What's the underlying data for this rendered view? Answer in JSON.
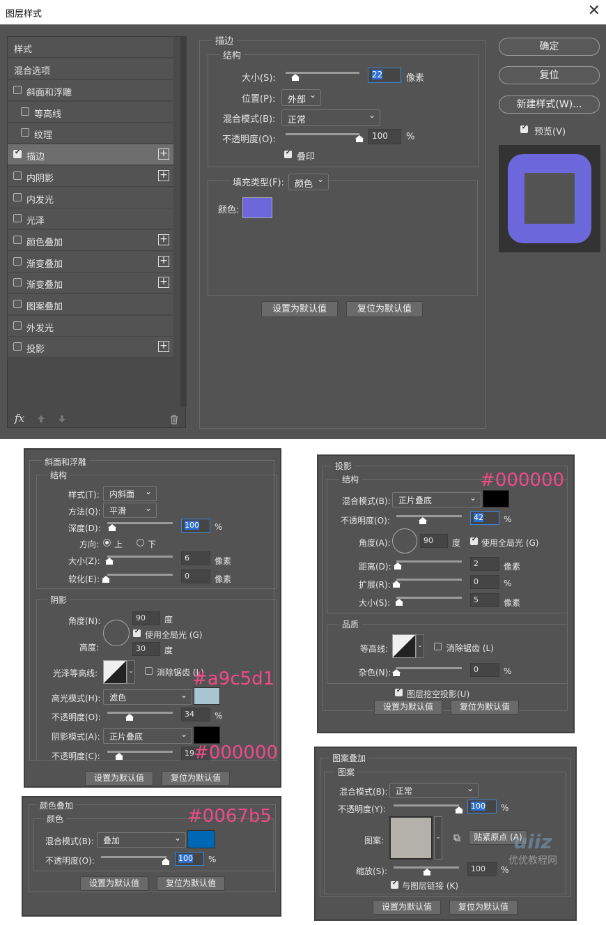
{
  "dialog": {
    "title": "图层样式",
    "close": "✕"
  },
  "styles_list": {
    "header": "样式",
    "blend_options": "混合选项",
    "items": [
      {
        "label": "斜面和浮雕",
        "checked": false,
        "plus": false
      },
      {
        "label": "等高线",
        "checked": false,
        "plus": false
      },
      {
        "label": "纹理",
        "checked": false,
        "plus": false
      },
      {
        "label": "描边",
        "checked": true,
        "plus": true
      },
      {
        "label": "内阴影",
        "checked": false,
        "plus": true
      },
      {
        "label": "内发光",
        "checked": false,
        "plus": false
      },
      {
        "label": "光泽",
        "checked": false,
        "plus": false
      },
      {
        "label": "颜色叠加",
        "checked": false,
        "plus": true
      },
      {
        "label": "渐变叠加",
        "checked": false,
        "plus": true
      },
      {
        "label": "渐变叠加",
        "checked": false,
        "plus": true
      },
      {
        "label": "图案叠加",
        "checked": false,
        "plus": false
      },
      {
        "label": "外发光",
        "checked": false,
        "plus": false
      },
      {
        "label": "投影",
        "checked": false,
        "plus": true
      }
    ],
    "fx": "fx",
    "plus_glyph": "+"
  },
  "stroke": {
    "title": "描边",
    "structure": "结构",
    "size_label": "大小(S):",
    "size_value": "22",
    "size_unit": "像素",
    "position_label": "位置(P):",
    "position_value": "外部",
    "blend_label": "混合模式(B):",
    "blend_value": "正常",
    "opacity_label": "不透明度(O):",
    "opacity_value": "100",
    "opacity_unit": "%",
    "overprint_label": "叠印",
    "fill_type_label": "填充类型(F):",
    "fill_type_value": "颜色",
    "color_label": "颜色:",
    "color": "#6d67dc",
    "make_default": "设置为默认值",
    "reset_default": "复位为默认值"
  },
  "right_buttons": {
    "ok": "确定",
    "reset": "复位",
    "new_style": "新建样式(W)...",
    "preview": "预览(V)"
  },
  "bevel": {
    "title": "斜面和浮雕",
    "structure": "结构",
    "style_label": "样式(T):",
    "style_value": "内斜面",
    "technique_label": "方法(Q):",
    "technique_value": "平滑",
    "depth_label": "深度(D):",
    "depth_value": "100",
    "pct": "%",
    "direction_label": "方向:",
    "dir_up": "上",
    "dir_down": "下",
    "size_label": "大小(Z):",
    "size_value": "6",
    "soften_label": "软化(E):",
    "soften_value": "0",
    "px": "像素",
    "shading": "阴影",
    "angle_label": "角度(N):",
    "angle_value": "90",
    "deg": "度",
    "global_light": "使用全局光 (G)",
    "altitude_label": "高度:",
    "altitude_value": "30",
    "gloss_label": "光泽等高线:",
    "anti_alias": "消除锯齿 (L)",
    "highlight_label": "高光模式(H):",
    "highlight_value": "滤色",
    "highlight_color": "#a9c5d1",
    "hl_opacity_label": "不透明度(O):",
    "hl_opacity_value": "34",
    "shadow_label": "阴影模式(A):",
    "shadow_value": "正片叠底",
    "shadow_color": "#000000",
    "sh_opacity_label": "不透明度(C):",
    "sh_opacity_value": "19",
    "ann_hl": "#a9c5d1",
    "ann_sh": "#000000",
    "make_default": "设置为默认值",
    "reset_default": "复位为默认值"
  },
  "color_overlay": {
    "title": "颜色叠加",
    "section": "颜色",
    "blend_label": "混合模式(B):",
    "blend_value": "叠加",
    "color": "#0067b5",
    "opacity_label": "不透明度(O):",
    "opacity_value": "100",
    "pct": "%",
    "ann": "#0067b5",
    "make_default": "设置为默认值",
    "reset_default": "复位为默认值"
  },
  "drop_shadow": {
    "title": "投影",
    "structure": "结构",
    "blend_label": "混合模式(B):",
    "blend_value": "正片叠底",
    "color": "#000000",
    "ann": "#000000",
    "opacity_label": "不透明度(O):",
    "opacity_value": "42",
    "pct": "%",
    "angle_label": "角度(A):",
    "angle_value": "90",
    "deg": "度",
    "global_light": "使用全局光 (G)",
    "distance_label": "距离(D):",
    "distance_value": "2",
    "px": "像素",
    "spread_label": "扩展(R):",
    "spread_value": "0",
    "size_label": "大小(S):",
    "size_value": "5",
    "quality": "品质",
    "contour_label": "等高线:",
    "anti_alias": "消除锯齿 (L)",
    "noise_label": "杂色(N):",
    "noise_value": "0",
    "knockout": "图层挖空投影(U)",
    "make_default": "设置为默认值",
    "reset_default": "复位为默认值"
  },
  "pattern_overlay": {
    "title": "图案叠加",
    "section": "图案",
    "blend_label": "混合模式(B):",
    "blend_value": "正常",
    "opacity_label": "不透明度(Y):",
    "opacity_value": "100",
    "pct": "%",
    "pattern_label": "图案:",
    "snap_origin": "贴紧原点 (A)",
    "scale_label": "缩放(S):",
    "scale_value": "100",
    "link_layer": "与图层链接 (K)",
    "make_default": "设置为默认值",
    "reset_default": "复位为默认值"
  },
  "watermark": {
    "logo": "uiiz",
    "caption": "优优教程网"
  }
}
